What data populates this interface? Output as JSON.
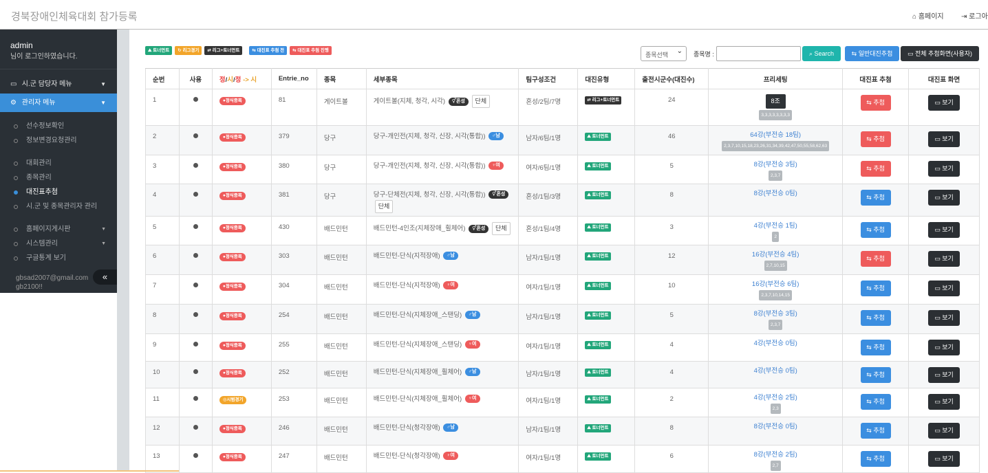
{
  "header": {
    "title": "경북장애인체육대회 참가등록",
    "home_label": "홈페이지",
    "logout_label": "로그아"
  },
  "sidebar": {
    "user_name": "admin",
    "user_msg": "님이 로그인하였습니다.",
    "menu1": "시.군 담당자 메뉴",
    "menu2": "관리자 메뉴",
    "items": [
      "선수정보확인",
      "정보변경요청관리",
      "대회관리",
      "종목관리",
      "대진표추첨",
      "시.군 및 종목관리자 관리",
      "홈페이지게시판",
      "시스템관리",
      "구글통계 보기"
    ],
    "email": "gbsad2007@gmail.com",
    "password": "gb2100!!",
    "collapse_icon": "«"
  },
  "legend": [
    "토너먼트",
    "리그경기",
    "리그+토너먼트",
    "대진표 추첨 전",
    "대진표 추첨 진행"
  ],
  "toolbar": {
    "select_value": "종목선택",
    "search_label": "종목명 :",
    "search_value": "",
    "search_btn": "Search",
    "general_btn": "일반대진추첨",
    "all_btn": "전체 추첨화면(사용자)"
  },
  "table": {
    "headers": [
      "순번",
      "사용",
      "정/시/정 -> 시",
      "Entrie_no",
      "종목",
      "세부종목",
      "팀구성조건",
      "대진유형",
      "출전시군수(대진수)",
      "프리세팅",
      "대진표 추첨",
      "대진표 화면"
    ],
    "rows": [
      {
        "no": "1",
        "status": "●정식종목",
        "entry": "81",
        "sport": "게이트볼",
        "detail": "게이트볼(지체, 청각, 시각)",
        "sex": "혼성",
        "danche": "단체",
        "team": "혼성/2팀/7명",
        "type": "리그+토너먼트",
        "count": "24",
        "preset": "8조",
        "preset_sub": "3,3,3,3,3,3,3,3",
        "draw": "추첨",
        "draw_color": "red",
        "view": "보기"
      },
      {
        "no": "2",
        "status": "●정식종목",
        "entry": "379",
        "sport": "당구",
        "detail": "당구-개인전(지체, 청각, 신장, 시각(통합))",
        "sex": "남",
        "danche": "",
        "team": "남자/6팀/1명",
        "type": "토너먼트",
        "count": "46",
        "preset": "64강(부전승 18팀)",
        "preset_sub": "2,3,7,10,15,18,23,26,31,34,39,42,47,50,55,58,62,63",
        "draw": "추첨",
        "draw_color": "red",
        "view": "보기"
      },
      {
        "no": "3",
        "status": "●정식종목",
        "entry": "380",
        "sport": "당구",
        "detail": "당구-개인전(지체, 청각, 신장, 시각(통합))",
        "sex": "여",
        "danche": "",
        "team": "여자/6팀/1명",
        "type": "토너먼트",
        "count": "5",
        "preset": "8강(부전승 3팀)",
        "preset_sub": "2,3,7",
        "draw": "추첨",
        "draw_color": "red",
        "view": "보기"
      },
      {
        "no": "4",
        "status": "●정식종목",
        "entry": "381",
        "sport": "당구",
        "detail": "당구-단체전(지체, 청각, 신장, 시각(통합))",
        "sex": "혼성",
        "danche": "단체",
        "team": "혼성/1팀/3명",
        "type": "토너먼트",
        "count": "8",
        "preset": "8강(부전승 0팀)",
        "preset_sub": "",
        "draw": "추첨",
        "draw_color": "blue",
        "view": "보기"
      },
      {
        "no": "5",
        "status": "●정식종목",
        "entry": "430",
        "sport": "배드민턴",
        "detail": "배드민턴-4인조(지체장애_휠체어)",
        "sex": "혼성",
        "danche": "단체",
        "team": "혼성/1팀/4명",
        "type": "토너먼트",
        "count": "3",
        "preset": "4강(부전승 1팀)",
        "preset_sub": "2",
        "draw": "추첨",
        "draw_color": "blue",
        "view": "보기"
      },
      {
        "no": "6",
        "status": "●정식종목",
        "entry": "303",
        "sport": "배드민턴",
        "detail": "배드민턴-단식(지적장애)",
        "sex": "남",
        "danche": "",
        "team": "남자/1팀/1명",
        "type": "토너먼트",
        "count": "12",
        "preset": "16강(부전승 4팀)",
        "preset_sub": "2,7,10,15",
        "draw": "추첨",
        "draw_color": "red",
        "view": "보기"
      },
      {
        "no": "7",
        "status": "●정식종목",
        "entry": "304",
        "sport": "배드민턴",
        "detail": "배드민턴-단식(지적장애)",
        "sex": "여",
        "danche": "",
        "team": "여자/1팀/1명",
        "type": "토너먼트",
        "count": "10",
        "preset": "16강(부전승 6팀)",
        "preset_sub": "2,3,7,10,14,15",
        "draw": "추첨",
        "draw_color": "blue",
        "view": "보기"
      },
      {
        "no": "8",
        "status": "●정식종목",
        "entry": "254",
        "sport": "배드민턴",
        "detail": "배드민턴-단식(지체장애_스탠딩)",
        "sex": "남",
        "danche": "",
        "team": "남자/1팀/1명",
        "type": "토너먼트",
        "count": "5",
        "preset": "8강(부전승 3팀)",
        "preset_sub": "2,3,7",
        "draw": "추첨",
        "draw_color": "blue",
        "view": "보기"
      },
      {
        "no": "9",
        "status": "●정식종목",
        "entry": "255",
        "sport": "배드민턴",
        "detail": "배드민턴-단식(지체장애_스탠딩)",
        "sex": "여",
        "danche": "",
        "team": "여자/1팀/1명",
        "type": "토너먼트",
        "count": "4",
        "preset": "4강(부전승 0팀)",
        "preset_sub": "",
        "draw": "추첨",
        "draw_color": "blue",
        "view": "보기"
      },
      {
        "no": "10",
        "status": "●정식종목",
        "entry": "252",
        "sport": "배드민턴",
        "detail": "배드민턴-단식(지체장애_휠체어)",
        "sex": "남",
        "danche": "",
        "team": "남자/1팀/1명",
        "type": "토너먼트",
        "count": "4",
        "preset": "4강(부전승 0팀)",
        "preset_sub": "",
        "draw": "추첨",
        "draw_color": "blue",
        "view": "보기"
      },
      {
        "no": "11",
        "status": "◎시범경기",
        "entry": "253",
        "sport": "배드민턴",
        "detail": "배드민턴-단식(지체장애_휠체어)",
        "sex": "여",
        "danche": "",
        "team": "여자/1팀/1명",
        "type": "토너먼트",
        "count": "2",
        "preset": "4강(부전승 2팀)",
        "preset_sub": "2,3",
        "draw": "추첨",
        "draw_color": "blue",
        "view": "보기"
      },
      {
        "no": "12",
        "status": "●정식종목",
        "entry": "246",
        "sport": "배드민턴",
        "detail": "배드민턴-단식(청각장애)",
        "sex": "남",
        "danche": "",
        "team": "남자/1팀/1명",
        "type": "토너먼트",
        "count": "8",
        "preset": "8강(부전승 0팀)",
        "preset_sub": "",
        "draw": "추첨",
        "draw_color": "blue",
        "view": "보기"
      },
      {
        "no": "13",
        "status": "●정식종목",
        "entry": "247",
        "sport": "배드민턴",
        "detail": "배드민턴-단식(청각장애)",
        "sex": "여",
        "danche": "",
        "team": "여자/1팀/1명",
        "type": "토너먼트",
        "count": "6",
        "preset": "8강(부전승 2팀)",
        "preset_sub": "2,7",
        "draw": "추첨",
        "draw_color": "blue",
        "view": "보기"
      }
    ]
  },
  "colors": {
    "red": "#ee5b5b",
    "blue": "#3b8ee0",
    "dark": "#2f3337",
    "green": "#22a67a",
    "orange": "#f2a52a",
    "accent": "#3a8fd9"
  }
}
